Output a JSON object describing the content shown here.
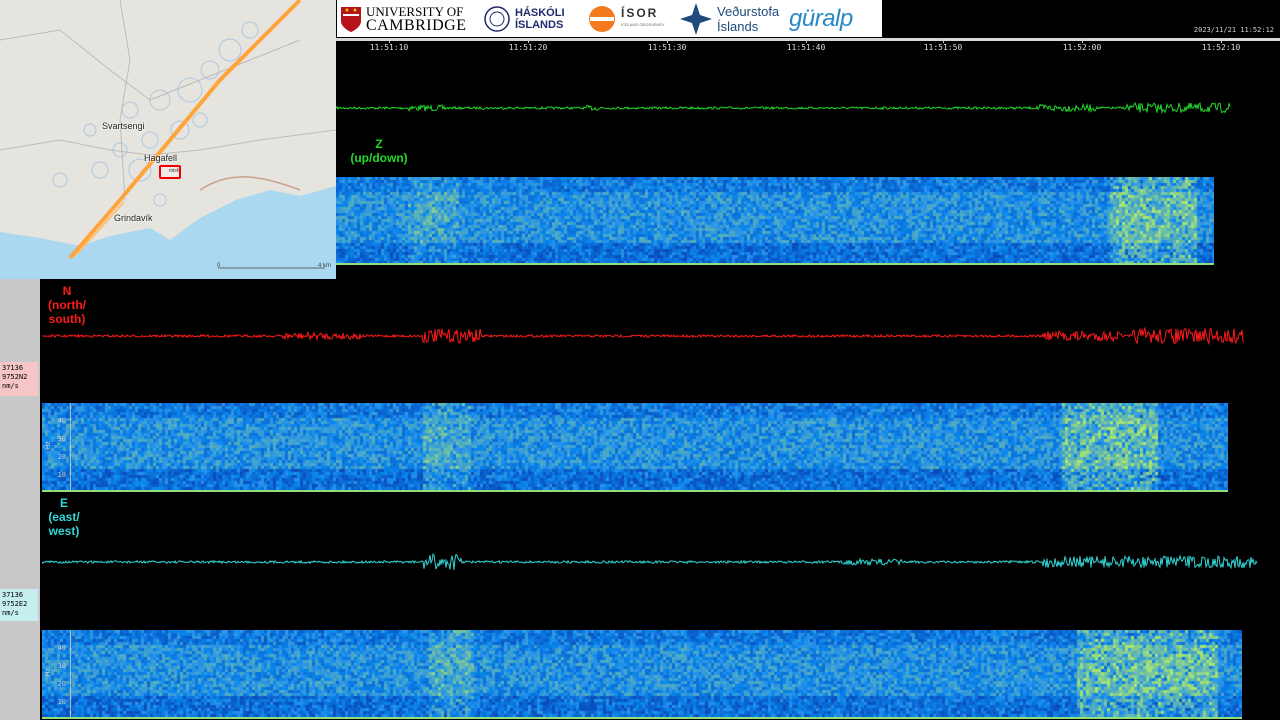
{
  "map": {
    "places": [
      "Svartsengi",
      "Hagafell",
      "Grindavík"
    ],
    "station_marker_label": "mish",
    "scale": {
      "start": "0",
      "end": "4 km"
    }
  },
  "logos": {
    "cambridge_line1": "UNIVERSITY OF",
    "cambridge_line2": "CAMBRIDGE",
    "haskoli_line1": "HÁSKÓLI",
    "haskoli_line2": "ÍSLANDS",
    "isor": "ÍSOR",
    "isor_sub": "ICELAND GEOSURVEY",
    "vedurstofa_line1": "Veðurstofa",
    "vedurstofa_line2": "Íslands",
    "guralp": "güralp"
  },
  "timestamp": "2023/11/21 11:52:12",
  "time_ticks": [
    "11:51:10",
    "11:51:20",
    "11:51:30",
    "11:51:40",
    "11:51:50",
    "11:52:00",
    "11:52:10"
  ],
  "channels": {
    "z": {
      "label_line1": "Z",
      "label_line2": "(up/down)",
      "color": "#22d82a"
    },
    "n": {
      "label_line1": "N",
      "label_line2": "(north/",
      "label_line3": "south)",
      "color": "#ff1a1a",
      "station_line1": "37136",
      "station_line2": "9752N2",
      "station_line3": "nm/s"
    },
    "e": {
      "label_line1": "E",
      "label_line2": "(east/",
      "label_line3": "west)",
      "color": "#33d6d6",
      "station_line1": "37136",
      "station_line2": "9752E2",
      "station_line3": "nm/s"
    }
  },
  "spectrogram": {
    "hz_ticks": [
      "40",
      "30",
      "20",
      "10"
    ],
    "hz_unit": "Hz"
  },
  "colors": {
    "spec_low": "#0a1fb0",
    "spec_mid": "#1f7fe6",
    "spec_high": "#a8e070",
    "background": "#000000"
  }
}
